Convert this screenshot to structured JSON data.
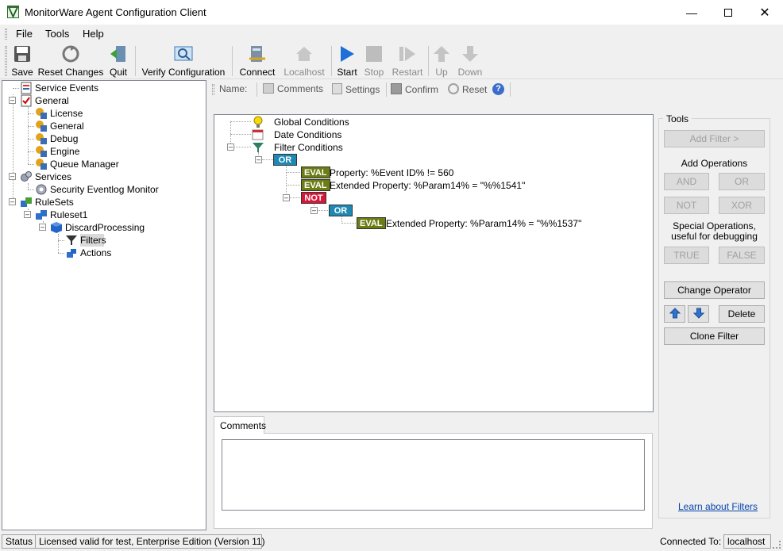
{
  "window": {
    "title": "MonitorWare Agent Configuration Client"
  },
  "menu": [
    "File",
    "Tools",
    "Help"
  ],
  "toolbar": {
    "save": "Save",
    "reset_changes": "Reset Changes",
    "quit": "Quit",
    "verify": "Verify Configuration",
    "connect": "Connect",
    "localhost": "Localhost",
    "start": "Start",
    "stop": "Stop",
    "restart": "Restart",
    "up": "Up",
    "down": "Down"
  },
  "left_tree": {
    "service_events": "Service Events",
    "general": "General",
    "license": "License",
    "general_sub": "General",
    "debug": "Debug",
    "engine": "Engine",
    "queue_manager": "Queue Manager",
    "services": "Services",
    "security_eventlog": "Security Eventlog Monitor",
    "rulesets": "RuleSets",
    "ruleset1": "Ruleset1",
    "discard": "DiscardProcessing",
    "filters": "Filters",
    "actions": "Actions"
  },
  "right_toolbar": {
    "name_label": "Name:",
    "comments": "Comments",
    "settings": "Settings",
    "confirm": "Confirm",
    "reset": "Reset"
  },
  "filter_tree": {
    "global": "Global Conditions",
    "date": "Date Conditions",
    "filter": "Filter Conditions",
    "or1": "OR",
    "eval1_badge": "EVAL",
    "eval1_text": "Property: %Event ID% != 560",
    "eval2_badge": "EVAL",
    "eval2_text": "Extended Property: %Param14% = \"%%1541\"",
    "not": "NOT",
    "or2": "OR",
    "eval3_badge": "EVAL",
    "eval3_text": "Extended Property: %Param14% = \"%%1537\""
  },
  "comments": {
    "tab": "Comments",
    "value": ""
  },
  "tools": {
    "title": "Tools",
    "add_filter": "Add Filter >",
    "add_operations": "Add Operations",
    "and": "AND",
    "or": "OR",
    "not": "NOT",
    "xor": "XOR",
    "special_line1": "Special Operations,",
    "special_line2": "useful for debugging",
    "true": "TRUE",
    "false": "FALSE",
    "change_operator": "Change Operator",
    "delete": "Delete",
    "clone_filter": "Clone Filter",
    "learn": "Learn about Filters"
  },
  "status": {
    "status_label": "Status",
    "license": "Licensed valid for test, Enterprise Edition (Version 11)",
    "connected_label": "Connected To:",
    "host": "localhost"
  },
  "colors": {
    "or": "#1d89b4",
    "eval": "#6b7d14",
    "not": "#d6173b",
    "accent": "#0645ad"
  }
}
